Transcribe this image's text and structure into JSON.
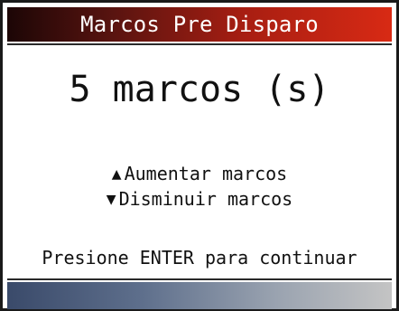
{
  "title": "Marcos Pre Disparo",
  "value_display": "5 marcos (s)",
  "options": {
    "increase": {
      "icon": "arrow-up-icon",
      "glyph": "▲",
      "label": "Aumentar marcos"
    },
    "decrease": {
      "icon": "arrow-down-icon",
      "glyph": "▼",
      "label": "Disminuir marcos"
    }
  },
  "hint": "Presione ENTER para continuar",
  "colors": {
    "title_bar_start": "#1c0606",
    "title_bar_end": "#d82a14",
    "footer_bar_start": "#3a4a6a",
    "footer_bar_end": "#c4c4c4",
    "text": "#111111",
    "background": "#ffffff"
  }
}
